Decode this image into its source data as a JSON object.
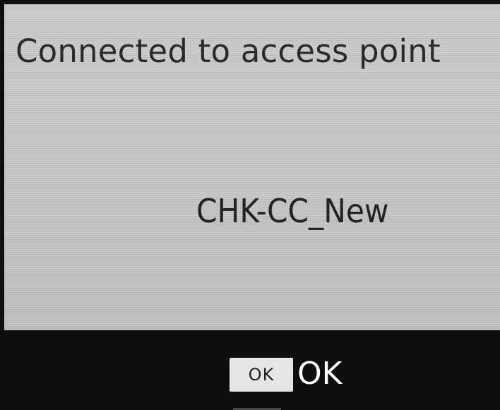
{
  "dialog": {
    "title": "Connected to access point",
    "ssid": "CHK-CC_New"
  },
  "footer": {
    "key_label": "OK",
    "action_label": "OK"
  },
  "colors": {
    "panel": "#c9c9c9",
    "bar": "#0e0e0e",
    "key_background": "#e6e6e6",
    "text": "#2a2a2a"
  }
}
